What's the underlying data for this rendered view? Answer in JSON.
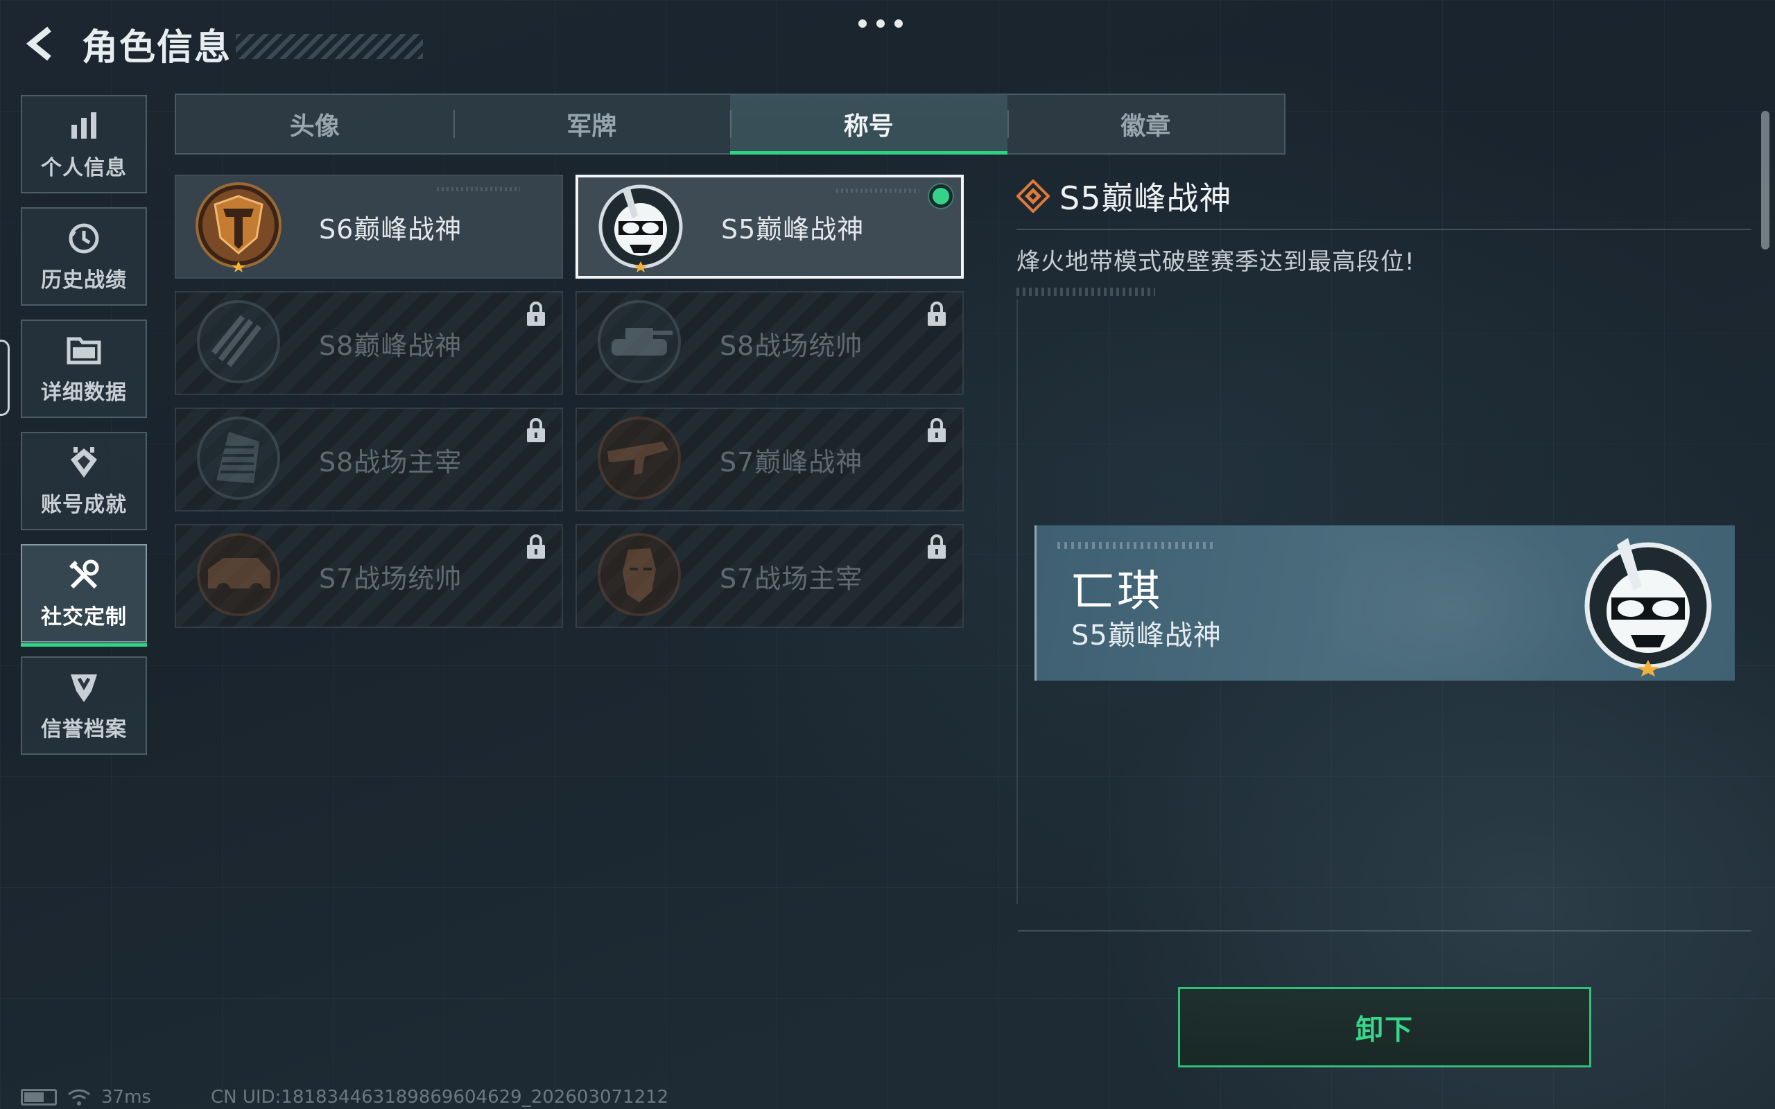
{
  "header": {
    "title": "角色信息"
  },
  "sidebar": {
    "items": [
      {
        "label": "个人信息",
        "icon": "bar-chart-icon",
        "active": false
      },
      {
        "label": "历史战绩",
        "icon": "history-clock-icon",
        "active": false
      },
      {
        "label": "详细数据",
        "icon": "folder-icon",
        "active": false
      },
      {
        "label": "账号成就",
        "icon": "achievement-icon",
        "active": false
      },
      {
        "label": "社交定制",
        "icon": "tools-icon",
        "active": true
      },
      {
        "label": "信誉档案",
        "icon": "credit-shield-icon",
        "active": false
      }
    ]
  },
  "tabs": [
    {
      "label": "头像",
      "active": false
    },
    {
      "label": "军牌",
      "active": false
    },
    {
      "label": "称号",
      "active": true
    },
    {
      "label": "徽章",
      "active": false
    }
  ],
  "titles": [
    {
      "name": "S6巅峰战神",
      "state": "owned",
      "medal": "gold-shield-medal-icon",
      "accent": "#b5742f"
    },
    {
      "name": "S5巅峰战神",
      "state": "equipped",
      "medal": "diver-skull-medal-icon",
      "accent": "#7c8a92"
    },
    {
      "name": "S8巅峰战神",
      "state": "locked",
      "medal": "slash-emblem-medal-icon",
      "accent": "#5d6d78"
    },
    {
      "name": "S8战场统帅",
      "state": "locked",
      "medal": "tank-medal-icon",
      "accent": "#5d6d78"
    },
    {
      "name": "S8战场主宰",
      "state": "locked",
      "medal": "tower-medal-icon",
      "accent": "#5d6d78"
    },
    {
      "name": "S7巅峰战神",
      "state": "locked",
      "medal": "rifle-medal-icon",
      "accent": "#7a4b33"
    },
    {
      "name": "S7战场统帅",
      "state": "locked",
      "medal": "armored-car-medal-icon",
      "accent": "#7a4b33"
    },
    {
      "name": "S7战场主宰",
      "state": "locked",
      "medal": "soldier-portrait-medal-icon",
      "accent": "#7a4b33"
    }
  ],
  "detail": {
    "title": "S5巅峰战神",
    "description": "烽火地带模式破壁赛季达到最高段位!"
  },
  "nameplate": {
    "player_name": "匸琪",
    "title": "S5巅峰战神"
  },
  "actions": {
    "unequip_label": "卸下"
  },
  "status": {
    "ping": "37ms",
    "uid": "CN UID:181834463189869604629_202603071212"
  },
  "colors": {
    "accent_green": "#2fd184",
    "orange_diamond": "#e07a3a"
  }
}
